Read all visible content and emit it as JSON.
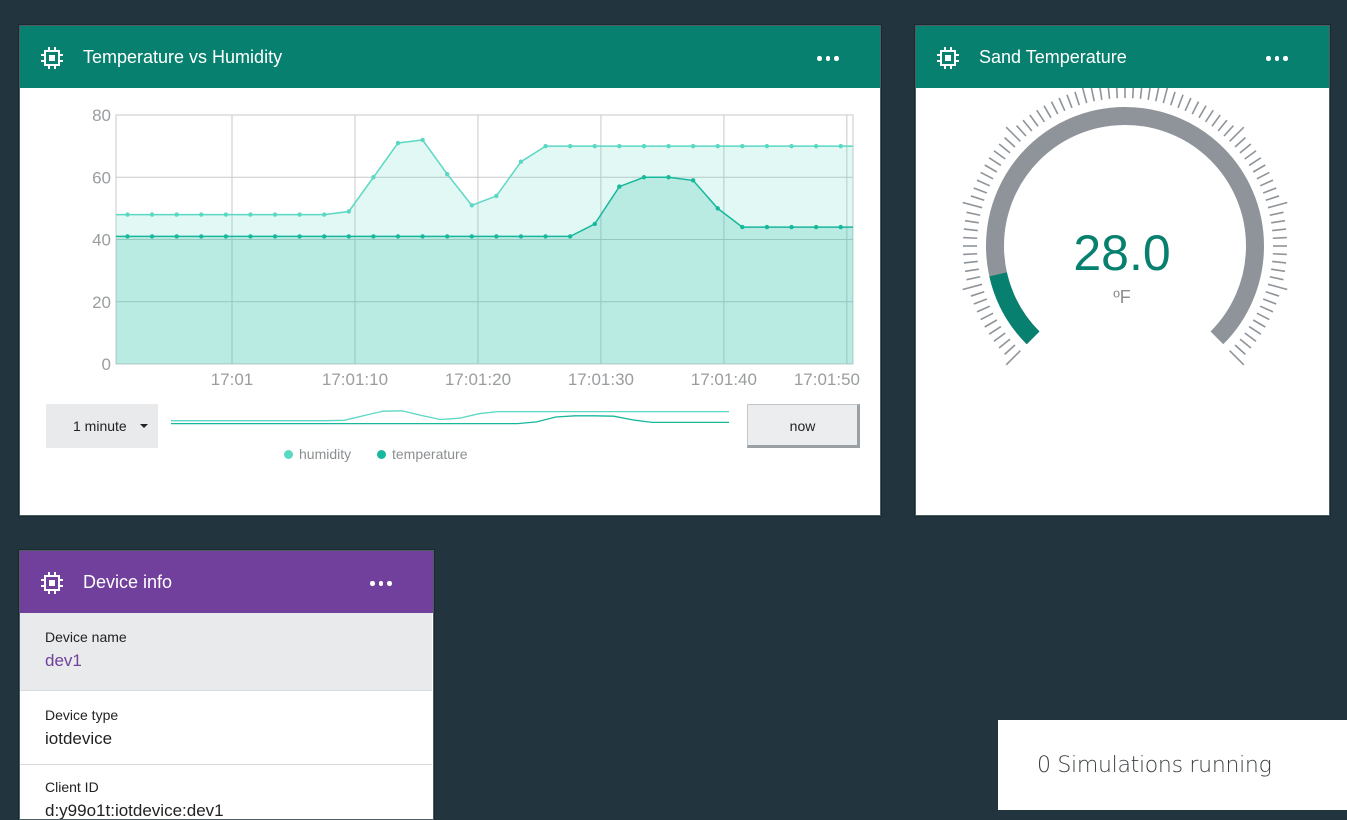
{
  "chart_card": {
    "title": "Temperature vs Humidity",
    "icon": "chip-icon",
    "range_label": "1 minute",
    "now_label": "now",
    "colors": {
      "header": "#08806f",
      "humidity": "#5bd8c3",
      "temperature": "#17b89c"
    }
  },
  "chart_data": {
    "type": "area",
    "ylim": [
      0,
      80
    ],
    "yticks": [
      "0",
      "20",
      "40",
      "60",
      "80"
    ],
    "xticks": [
      "17:01",
      "17:01:10",
      "17:01:20",
      "17:01:30",
      "17:01:40",
      "17:01:50"
    ],
    "x_seconds": [
      -8.5,
      -6.5,
      -4.5,
      -2.5,
      -0.5,
      1.5,
      3.5,
      5.5,
      7.5,
      9.5,
      11.5,
      13.5,
      15.5,
      17.5,
      19.5,
      21.5,
      23.5,
      25.5,
      27.5,
      29.5,
      31.5,
      33.5,
      35.5,
      37.5,
      39.5,
      41.5,
      43.5,
      45.5,
      47.5,
      49.5
    ],
    "series": [
      {
        "name": "humidity",
        "values": [
          48,
          48,
          48,
          48,
          48,
          48,
          48,
          48,
          48,
          49,
          60,
          71,
          72,
          61,
          51,
          54,
          65,
          70,
          70,
          70,
          70,
          70,
          70,
          70,
          70,
          70,
          70,
          70,
          70,
          70
        ]
      },
      {
        "name": "temperature",
        "values": [
          41,
          41,
          41,
          41,
          41,
          41,
          41,
          41,
          41,
          41,
          41,
          41,
          41,
          41,
          41,
          41,
          41,
          41,
          41,
          45,
          57,
          60,
          60,
          59,
          50,
          44,
          44,
          44,
          44,
          44
        ]
      }
    ],
    "legend": [
      "humidity",
      "temperature"
    ]
  },
  "gauge_card": {
    "title": "Sand Temperature",
    "value": "28.0",
    "unit": "ºF",
    "fill_fraction": 0.12
  },
  "device_card": {
    "title": "Device info",
    "rows": [
      {
        "label": "Device name",
        "value": "dev1"
      },
      {
        "label": "Device type",
        "value": "iotdevice"
      },
      {
        "label": "Client ID",
        "value": "d:y99o1t:iotdevice:dev1"
      }
    ]
  },
  "simulations": {
    "text": "0 Simulations running"
  }
}
